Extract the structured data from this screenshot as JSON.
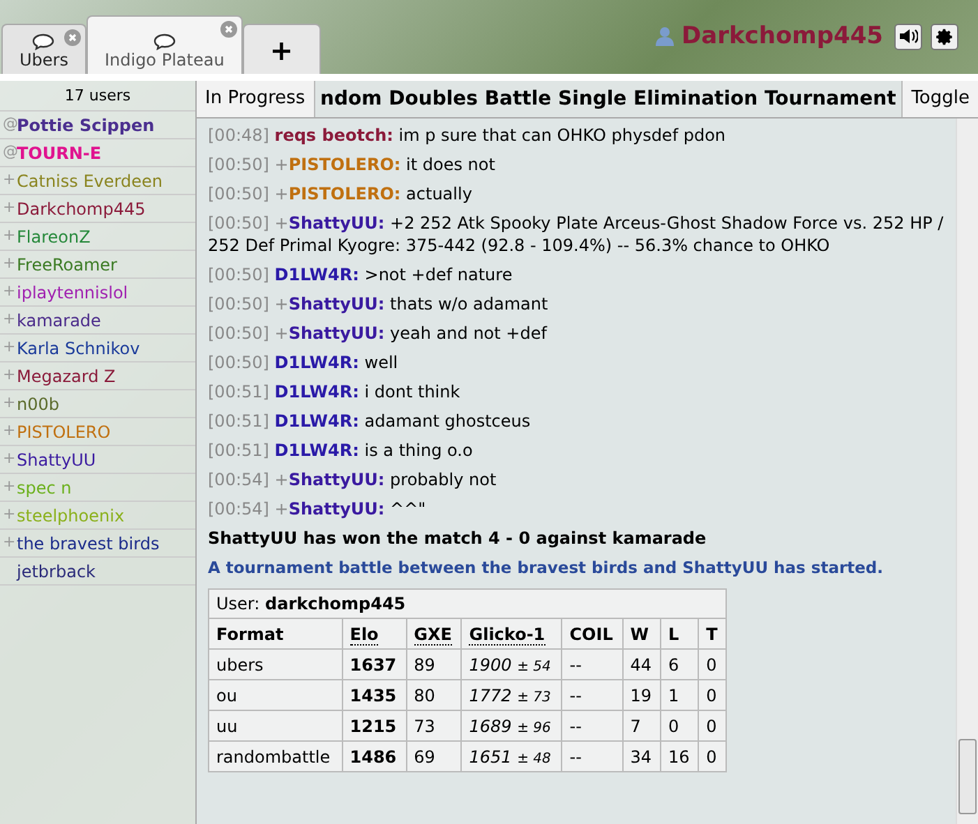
{
  "tabs": [
    {
      "label": "Ubers",
      "selected": false
    },
    {
      "label": "Indigo Plateau",
      "selected": true
    }
  ],
  "new_tab": {
    "label": "+"
  },
  "user": {
    "name": "Darkchomp445"
  },
  "sidebar": {
    "count": "17 users",
    "users": [
      {
        "rank": "@",
        "name": "Pottie Scippen",
        "color": "#4b2f8f",
        "bold": true
      },
      {
        "rank": "@",
        "name": "TOURN-E",
        "color": "#e0138f",
        "bold": true
      },
      {
        "rank": "+",
        "name": "Catniss Everdeen",
        "color": "#8a841f",
        "bold": false
      },
      {
        "rank": "+",
        "name": "Darkchomp445",
        "color": "#8b1a3a",
        "bold": false
      },
      {
        "rank": "+",
        "name": "FlareonZ",
        "color": "#25883a",
        "bold": false
      },
      {
        "rank": "+",
        "name": "FreeRoamer",
        "color": "#3a7a22",
        "bold": false
      },
      {
        "rank": "+",
        "name": "iplaytennislol",
        "color": "#a020b0",
        "bold": false
      },
      {
        "rank": "+",
        "name": "kamarade",
        "color": "#4a2a8a",
        "bold": false
      },
      {
        "rank": "+",
        "name": "Karla Schnikov",
        "color": "#1a3a9a",
        "bold": false
      },
      {
        "rank": "+",
        "name": "Megazard Z",
        "color": "#8a1a3a",
        "bold": false
      },
      {
        "rank": "+",
        "name": "n00b",
        "color": "#5a6a2a",
        "bold": false
      },
      {
        "rank": "+",
        "name": "PISTOLERO",
        "color": "#c07010",
        "bold": false
      },
      {
        "rank": "+",
        "name": "ShattyUU",
        "color": "#3a1aa0",
        "bold": false
      },
      {
        "rank": "+",
        "name": "spec n",
        "color": "#6ab01a",
        "bold": false
      },
      {
        "rank": "+",
        "name": "steelphoenix",
        "color": "#8ab01a",
        "bold": false
      },
      {
        "rank": "+",
        "name": "the bravest birds",
        "color": "#1a2a8a",
        "bold": false
      },
      {
        "name": "jetbrback",
        "color": "#2a2a7a",
        "bold": false
      }
    ]
  },
  "tournament_bar": {
    "status_button": "In Progress",
    "title": "ndom Doubles Battle Single Elimination Tournament",
    "toggle_button": "Toggle"
  },
  "messages": [
    {
      "kind": "chat",
      "time": "[00:48]",
      "user": "reqs beotch:",
      "color": "#8b1a3a",
      "text": "im p sure that can OHKO physdef pdon"
    },
    {
      "kind": "chat",
      "time": "[00:50]",
      "rank": "+",
      "user": "PISTOLERO:",
      "color": "#c07010",
      "text": "it does not"
    },
    {
      "kind": "chat",
      "time": "[00:50]",
      "rank": "+",
      "user": "PISTOLERO:",
      "color": "#c07010",
      "text": "actually"
    },
    {
      "kind": "chat",
      "time": "[00:50]",
      "rank": "+",
      "user": "ShattyUU:",
      "color": "#3a1aa0",
      "text": "+2 252 Atk Spooky Plate Arceus-Ghost Shadow Force vs. 252 HP / 252 Def Primal Kyogre: 375-442 (92.8 - 109.4%) -- 56.3% chance to OHKO"
    },
    {
      "kind": "chat",
      "time": "[00:50]",
      "user": "D1LW4R:",
      "color": "#2a1aa8",
      "text": ">not +def nature"
    },
    {
      "kind": "chat",
      "time": "[00:50]",
      "rank": "+",
      "user": "ShattyUU:",
      "color": "#3a1aa0",
      "text": "thats w/o adamant"
    },
    {
      "kind": "chat",
      "time": "[00:50]",
      "rank": "+",
      "user": "ShattyUU:",
      "color": "#3a1aa0",
      "text": "yeah and not +def"
    },
    {
      "kind": "chat",
      "time": "[00:50]",
      "user": "D1LW4R:",
      "color": "#2a1aa8",
      "text": "well"
    },
    {
      "kind": "chat",
      "time": "[00:51]",
      "user": "D1LW4R:",
      "color": "#2a1aa8",
      "text": "i dont think"
    },
    {
      "kind": "chat",
      "time": "[00:51]",
      "user": "D1LW4R:",
      "color": "#2a1aa8",
      "text": "adamant ghostceus"
    },
    {
      "kind": "chat",
      "time": "[00:51]",
      "user": "D1LW4R:",
      "color": "#2a1aa8",
      "text": "is a thing o.o"
    },
    {
      "kind": "chat",
      "time": "[00:54]",
      "rank": "+",
      "user": "ShattyUU:",
      "color": "#3a1aa0",
      "text": "probably not"
    },
    {
      "kind": "chat",
      "time": "[00:54]",
      "rank": "+",
      "user": "ShattyUU:",
      "color": "#3a1aa0",
      "text": "^^\""
    },
    {
      "kind": "notice",
      "text": "ShattyUU has won the match 4 - 0 against kamarade"
    },
    {
      "kind": "announce",
      "text": "A tournament battle between the bravest birds and ShattyUU has started."
    }
  ],
  "rank_table": {
    "user_label": "User:",
    "user": "darkchomp445",
    "columns": [
      {
        "label": "Format",
        "dotted": false
      },
      {
        "label": "Elo",
        "dotted": true
      },
      {
        "label": "GXE",
        "dotted": true
      },
      {
        "label": "Glicko-1",
        "dotted": true
      },
      {
        "label": "COIL",
        "dotted": false
      },
      {
        "label": "W",
        "dotted": false
      },
      {
        "label": "L",
        "dotted": false
      },
      {
        "label": "T",
        "dotted": false
      }
    ],
    "rows": [
      {
        "format": "ubers",
        "elo": "1637",
        "gxe": "89",
        "glicko": "1900",
        "deviation": "± 54",
        "coil": "--",
        "w": "44",
        "l": "6",
        "t": "0"
      },
      {
        "format": "ou",
        "elo": "1435",
        "gxe": "80",
        "glicko": "1772",
        "deviation": "± 73",
        "coil": "--",
        "w": "19",
        "l": "1",
        "t": "0"
      },
      {
        "format": "uu",
        "elo": "1215",
        "gxe": "73",
        "glicko": "1689",
        "deviation": "± 96",
        "coil": "--",
        "w": "7",
        "l": "0",
        "t": "0"
      },
      {
        "format": "randombattle",
        "elo": "1486",
        "gxe": "69",
        "glicko": "1651",
        "deviation": "± 48",
        "coil": "--",
        "w": "34",
        "l": "16",
        "t": "0"
      }
    ]
  }
}
